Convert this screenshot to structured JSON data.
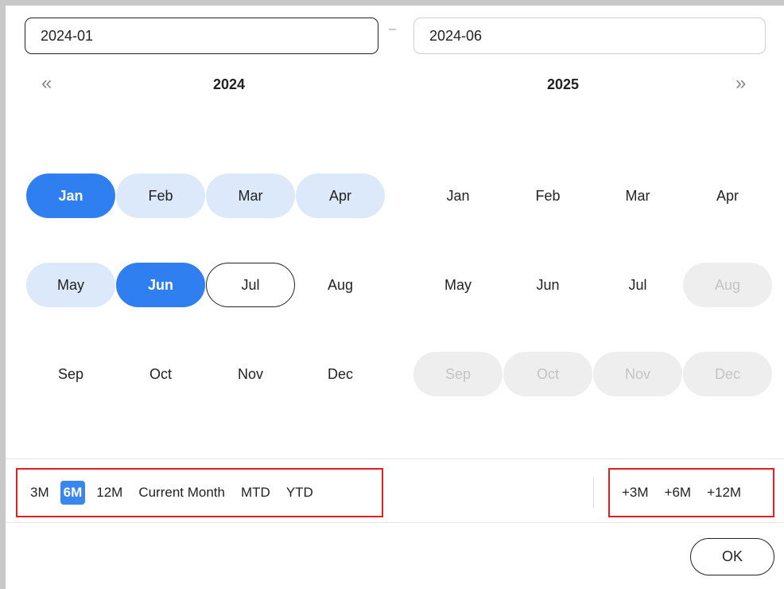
{
  "range": {
    "start_value": "2024-01",
    "end_value": "2024-06",
    "separator": "–"
  },
  "nav": {
    "prev_icon": "«",
    "next_icon": "»"
  },
  "panels": [
    {
      "year": "2024",
      "months": [
        {
          "label": "Jan",
          "state": "selected"
        },
        {
          "label": "Feb",
          "state": "range"
        },
        {
          "label": "Mar",
          "state": "range"
        },
        {
          "label": "Apr",
          "state": "range"
        },
        {
          "label": "May",
          "state": "range"
        },
        {
          "label": "Jun",
          "state": "selected"
        },
        {
          "label": "Jul",
          "state": "today"
        },
        {
          "label": "Aug",
          "state": "normal"
        },
        {
          "label": "Sep",
          "state": "normal"
        },
        {
          "label": "Oct",
          "state": "normal"
        },
        {
          "label": "Nov",
          "state": "normal"
        },
        {
          "label": "Dec",
          "state": "normal"
        }
      ]
    },
    {
      "year": "2025",
      "months": [
        {
          "label": "Jan",
          "state": "normal"
        },
        {
          "label": "Feb",
          "state": "normal"
        },
        {
          "label": "Mar",
          "state": "normal"
        },
        {
          "label": "Apr",
          "state": "normal"
        },
        {
          "label": "May",
          "state": "normal"
        },
        {
          "label": "Jun",
          "state": "normal"
        },
        {
          "label": "Jul",
          "state": "normal"
        },
        {
          "label": "Aug",
          "state": "disabled"
        },
        {
          "label": "Sep",
          "state": "disabled"
        },
        {
          "label": "Oct",
          "state": "disabled"
        },
        {
          "label": "Nov",
          "state": "disabled"
        },
        {
          "label": "Dec",
          "state": "disabled"
        }
      ]
    }
  ],
  "presets": {
    "back": [
      {
        "label": "3M",
        "active": false
      },
      {
        "label": "6M",
        "active": true
      },
      {
        "label": "12M",
        "active": false
      },
      {
        "label": "Current Month",
        "active": false
      },
      {
        "label": "MTD",
        "active": false
      },
      {
        "label": "YTD",
        "active": false
      }
    ],
    "forward": [
      {
        "label": "+3M",
        "active": false
      },
      {
        "label": "+6M",
        "active": false
      },
      {
        "label": "+12M",
        "active": false
      }
    ]
  },
  "ok_label": "OK",
  "colors": {
    "accent": "#2f7ff0",
    "range_bg": "#dce9fb",
    "disabled_bg": "#eeeeee",
    "highlight_box": "#e41e1e"
  }
}
